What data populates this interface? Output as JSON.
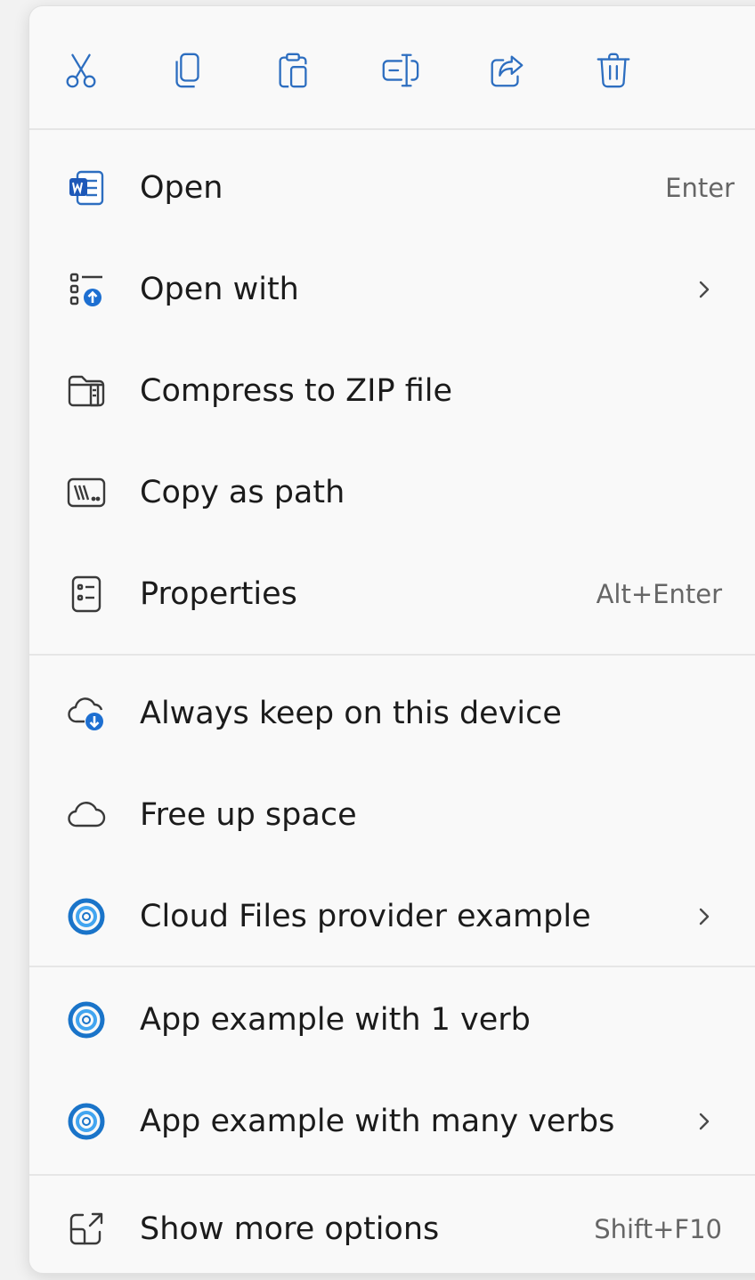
{
  "toolbar": {
    "buttons": [
      {
        "name": "cut",
        "icon": "scissors-icon"
      },
      {
        "name": "copy",
        "icon": "copy-icon"
      },
      {
        "name": "paste",
        "icon": "paste-icon"
      },
      {
        "name": "rename",
        "icon": "rename-icon"
      },
      {
        "name": "share",
        "icon": "share-icon"
      },
      {
        "name": "delete",
        "icon": "trash-icon"
      }
    ],
    "icon_color": "#2d6ec0"
  },
  "items": {
    "open": {
      "label": "Open",
      "accelerator": "Enter",
      "icon": "word-document-icon"
    },
    "open_with": {
      "label": "Open with",
      "icon": "open-with-icon",
      "submenu": true
    },
    "compress": {
      "label": "Compress to ZIP file",
      "icon": "zip-folder-icon"
    },
    "copy_path": {
      "label": "Copy as path",
      "icon": "copy-path-icon"
    },
    "properties": {
      "label": "Properties",
      "accelerator": "Alt+Enter",
      "icon": "properties-icon"
    },
    "keep_device": {
      "label": "Always keep on this device",
      "icon": "cloud-download-icon"
    },
    "free_space": {
      "label": "Free up space",
      "icon": "cloud-icon"
    },
    "cloud_provider": {
      "label": "Cloud Files provider example",
      "icon": "app-ring-icon",
      "submenu": true
    },
    "app_one_verb": {
      "label": "App example with 1 verb",
      "icon": "app-ring-icon"
    },
    "app_many_verbs": {
      "label": "App example with many verbs",
      "icon": "app-ring-icon",
      "submenu": true
    },
    "show_more": {
      "label": "Show more options",
      "accelerator": "Shift+F10",
      "icon": "show-more-icon"
    }
  },
  "colors": {
    "accent": "#2d6ec0",
    "text": "#1b1b1b",
    "accelerator_text": "#666666",
    "menu_background": "#f9f9f9",
    "separator": "#e6e6e6"
  }
}
